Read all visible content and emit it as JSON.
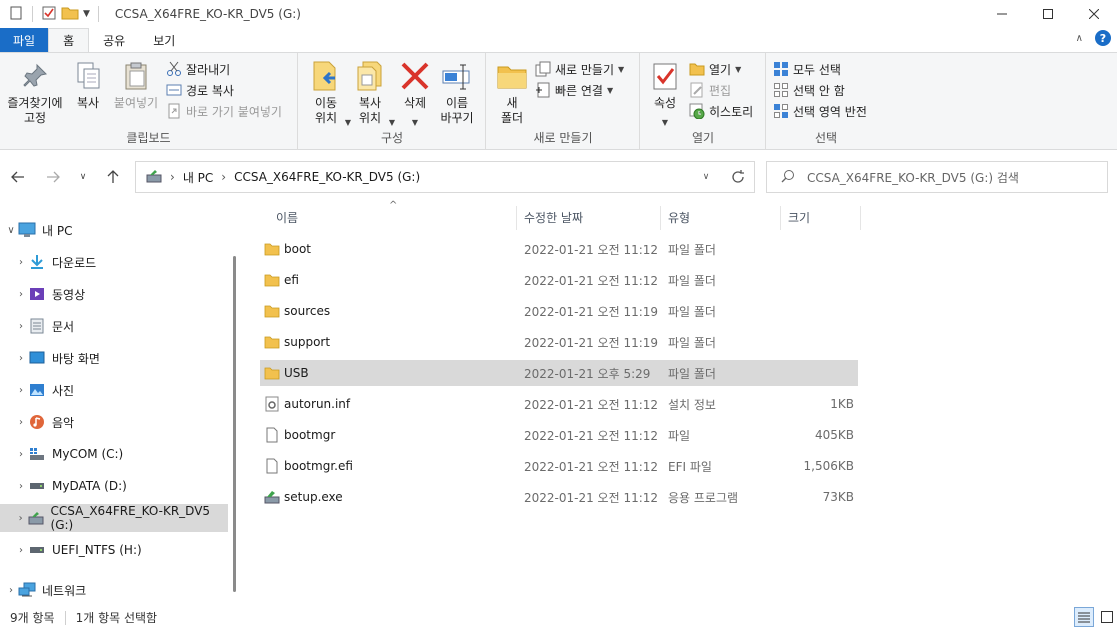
{
  "window": {
    "title": "CCSA_X64FRE_KO-KR_DV5 (G:)"
  },
  "ribbon_tabs": [
    "파일",
    "홈",
    "공유",
    "보기"
  ],
  "ribbon": {
    "clipboard": {
      "label": "클립보드",
      "pin": "즐겨찾기에\n고정",
      "copy": "복사",
      "paste": "붙여넣기",
      "cut": "잘라내기",
      "copy_path": "경로 복사",
      "paste_shortcut": "바로 가기 붙여넣기"
    },
    "organize": {
      "label": "구성",
      "move_to": "이동\n위치",
      "copy_to": "복사\n위치",
      "delete": "삭제",
      "rename": "이름\n바꾸기"
    },
    "new": {
      "label": "새로 만들기",
      "new_folder": "새\n폴더",
      "new_item": "새로 만들기",
      "easy_access": "빠른 연결"
    },
    "open": {
      "label": "열기",
      "properties": "속성",
      "open": "열기",
      "edit": "편집",
      "history": "히스토리"
    },
    "select": {
      "label": "선택",
      "select_all": "모두 선택",
      "select_none": "선택 안 함",
      "invert": "선택 영역 반전"
    }
  },
  "address": {
    "crumbs": [
      "내 PC",
      "CCSA_X64FRE_KO-KR_DV5 (G:)"
    ],
    "search_placeholder": "CCSA_X64FRE_KO-KR_DV5 (G:) 검색"
  },
  "nav_tree": [
    {
      "label": "내 PC",
      "icon": "pc-icon",
      "expanded": true
    },
    {
      "label": "다운로드",
      "icon": "download-icon"
    },
    {
      "label": "동영상",
      "icon": "video-icon"
    },
    {
      "label": "문서",
      "icon": "document-icon"
    },
    {
      "label": "바탕 화면",
      "icon": "desktop-icon"
    },
    {
      "label": "사진",
      "icon": "pictures-icon"
    },
    {
      "label": "음악",
      "icon": "music-icon"
    },
    {
      "label": "MyCOM (C:)",
      "icon": "windows-drive-icon"
    },
    {
      "label": "MyDATA (D:)",
      "icon": "drive-icon"
    },
    {
      "label": "CCSA_X64FRE_KO-KR_DV5 (G:)",
      "icon": "dvd-drive-icon",
      "selected": true
    },
    {
      "label": "UEFI_NTFS (H:)",
      "icon": "drive-icon"
    },
    {
      "label": "네트워크",
      "icon": "network-icon"
    }
  ],
  "columns": {
    "name": "이름",
    "modified": "수정한 날짜",
    "type": "유형",
    "size": "크기"
  },
  "files": [
    {
      "name": "boot",
      "modified": "2022-01-21 오전 11:12",
      "type": "파일 폴더",
      "size": "",
      "icon": "folder-icon"
    },
    {
      "name": "efi",
      "modified": "2022-01-21 오전 11:12",
      "type": "파일 폴더",
      "size": "",
      "icon": "folder-icon"
    },
    {
      "name": "sources",
      "modified": "2022-01-21 오전 11:19",
      "type": "파일 폴더",
      "size": "",
      "icon": "folder-icon"
    },
    {
      "name": "support",
      "modified": "2022-01-21 오전 11:19",
      "type": "파일 폴더",
      "size": "",
      "icon": "folder-icon"
    },
    {
      "name": "USB",
      "modified": "2022-01-21 오후 5:29",
      "type": "파일 폴더",
      "size": "",
      "icon": "folder-icon",
      "selected": true
    },
    {
      "name": "autorun.inf",
      "modified": "2022-01-21 오전 11:12",
      "type": "설치 정보",
      "size": "1KB",
      "icon": "settings-file-icon"
    },
    {
      "name": "bootmgr",
      "modified": "2022-01-21 오전 11:12",
      "type": "파일",
      "size": "405KB",
      "icon": "file-icon"
    },
    {
      "name": "bootmgr.efi",
      "modified": "2022-01-21 오전 11:12",
      "type": "EFI 파일",
      "size": "1,506KB",
      "icon": "file-icon"
    },
    {
      "name": "setup.exe",
      "modified": "2022-01-21 오전 11:12",
      "type": "응용 프로그램",
      "size": "73KB",
      "icon": "setup-exe-icon"
    }
  ],
  "status": {
    "count": "9개 항목",
    "selected": "1개 항목 선택함"
  },
  "colors": {
    "accent": "#1a6dc7",
    "folder": "#f2c14e",
    "selection": "#d9d9d9"
  }
}
